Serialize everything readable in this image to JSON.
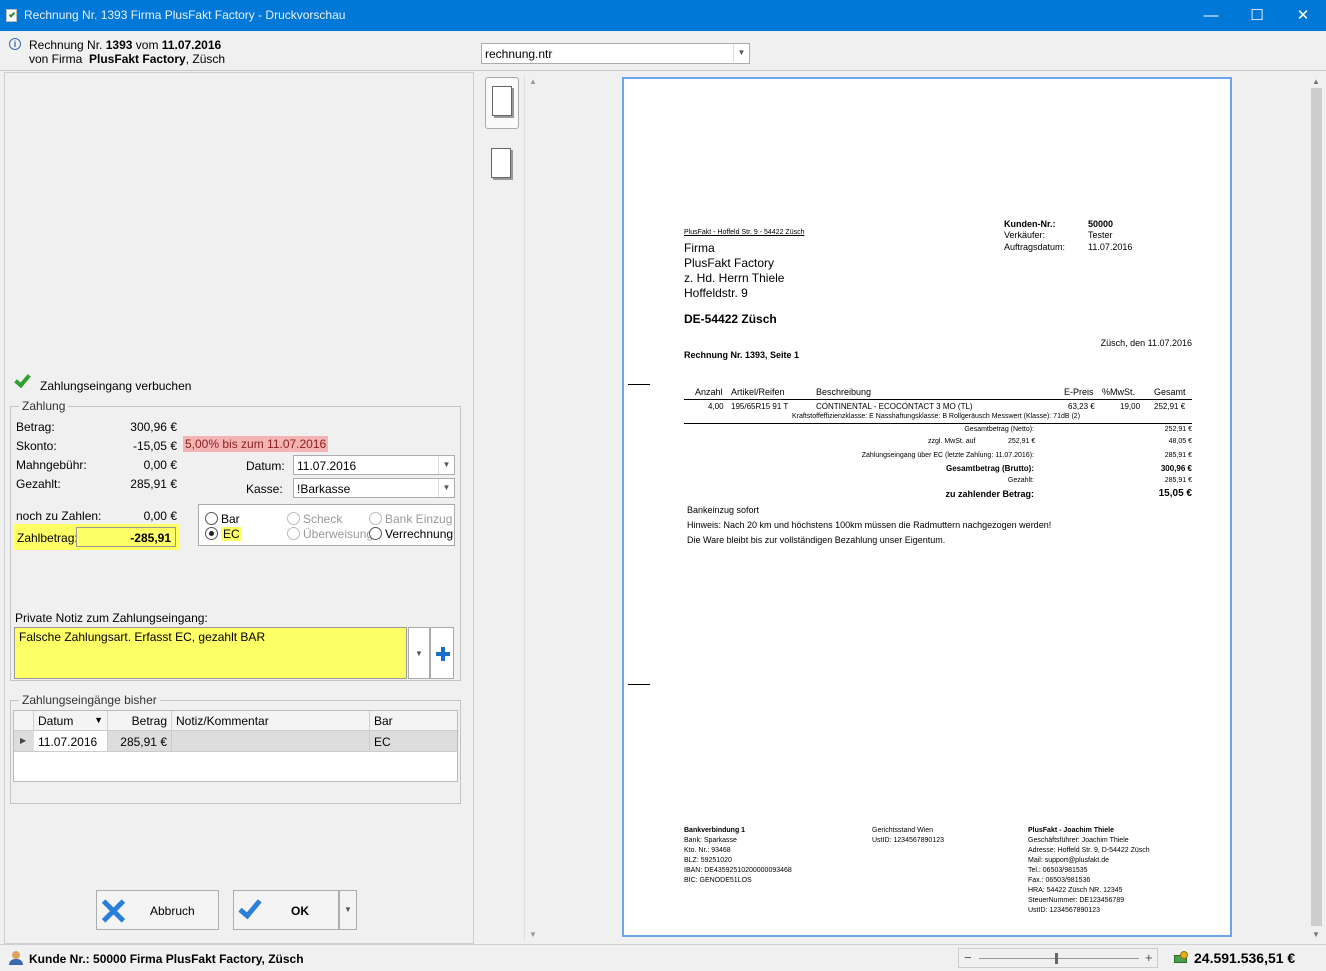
{
  "window": {
    "title": "Rechnung Nr. 1393 Firma PlusFakt Factory - Druckvorschau",
    "controls": {
      "minimize": "—",
      "maximize": "☐",
      "close": "✕"
    }
  },
  "info": {
    "line1_prefix": "Rechnung Nr.",
    "invoice_no": "1393",
    "line1_mid": "vom",
    "invoice_date": "11.07.2016",
    "line2_prefix": "von Firma",
    "company": "PlusFakt Factory",
    "line2_suffix": ", Züsch"
  },
  "template": {
    "value": "rechnung.ntr"
  },
  "payment": {
    "book_label": "Zahlungseingang verbuchen",
    "group_title": "Zahlung",
    "betrag_label": "Betrag:",
    "betrag": "300,96 €",
    "skonto_label": "Skonto:",
    "skonto": "-15,05 €",
    "skonto_note": "5,00% bis zum 11.07.2016",
    "mahn_label": "Mahngebühr:",
    "mahn": "0,00 €",
    "gezahlt_label": "Gezahlt:",
    "gezahlt": "285,91 €",
    "noch_label": "noch zu Zahlen:",
    "noch": "0,00 €",
    "zahlbetrag_label": "Zahlbetrag:",
    "zahlbetrag": "-285,91",
    "datum_label": "Datum:",
    "datum": "11.07.2016",
    "kasse_label": "Kasse:",
    "kasse": "!Barkasse",
    "methods": {
      "bar": "Bar",
      "scheck": "Scheck",
      "bank": "Bank Einzug",
      "ec": "EC",
      "ueberweisung": "Überweisung",
      "verrechnung": "Verrechnung"
    },
    "note_label": "Private Notiz zum Zahlungseingang:",
    "note": "Falsche Zahlungsart. Erfasst EC, gezahlt BAR"
  },
  "history": {
    "title": "Zahlungseingänge bisher",
    "headers": {
      "datum": "Datum",
      "betrag": "Betrag",
      "notiz": "Notiz/Kommentar",
      "bar": "Bar"
    },
    "row": {
      "datum": "11.07.2016",
      "betrag": "285,91 €",
      "notiz": "",
      "bar": "EC"
    }
  },
  "buttons": {
    "cancel": "Abbruch",
    "ok": "OK"
  },
  "doc": {
    "sender": "PlusFakt - Hoffeld Str. 9 - 54422 Züsch",
    "addr1": "Firma",
    "addr2": "PlusFakt Factory",
    "addr3": "z. Hd. Herrn Thiele",
    "addr4": "Hoffeldstr. 9",
    "city": "DE-54422 Züsch",
    "kd_label": "Kunden-Nr.:",
    "kd": "50000",
    "vk_label": "Verkäufer:",
    "vk": "Tester",
    "ad_label": "Auftragsdatum:",
    "ad": "11.07.2016",
    "place_date": "Züsch, den 11.07.2016",
    "heading": "Rechnung Nr. 1393, Seite 1",
    "th": {
      "anzahl": "Anzahl",
      "artikel": "Artikel/Reifen",
      "beschr": "Beschreibung",
      "epreis": "E-Preis",
      "mwst": "%MwSt.",
      "gesamt": "Gesamt"
    },
    "item": {
      "anzahl": "4,00",
      "artikel": "195/65R15 91 T",
      "beschr": "CONTINENTAL - ECOCONTACT 3 MO (TL)",
      "epreis": "63,23 €",
      "mwst": "19,00",
      "gesamt": "252,91 €"
    },
    "item_sub": "Kraftstoffeffizienzklasse: E   Nasshaftungsklasse: B   Rollgeräusch Messwert (Klasse): 71dB (2)",
    "sum_netto_label": "Gesamtbetrag (Netto):",
    "sum_netto": "252,91 €",
    "sum_mwst_label": "zzgl.  MwSt. auf",
    "sum_mwst_base": "252,91 €",
    "sum_mwst": "48,05 €",
    "sum_ze_label": "Zahlungseingang über EC (letzte Zahlung: 11.07.2016):",
    "sum_ze": "285,91 €",
    "sum_brutto_label": "Gesamtbetrag (Brutto):",
    "sum_brutto": "300,96 €",
    "sum_gez_label": "Gezahlt:",
    "sum_gez": "285,91 €",
    "sum_zahl_label": "zu zahlender Betrag:",
    "sum_zahl": "15,05 €",
    "txt1": "Bankeinzug sofort",
    "txt2": "Hinweis: Nach 20 km und höchstens 100km müssen die Radmuttern nachgezogen werden!",
    "txt3": "Die Ware bleibt bis zur vollständigen Bezahlung unser Eigentum.",
    "f1": [
      "Bankverbindung 1",
      "Bank: Sparkasse",
      "Kto. Nr.: 93468",
      "BLZ: 59251020",
      "IBAN: DE43592510200000093468",
      "BIC: GENODE51LOS"
    ],
    "f2": [
      "Gerichtsstand Wien",
      "UstID: 1234567890123"
    ],
    "f3": [
      "PlusFakt - Joachim Thiele",
      "Geschäftsführer: Joachim Thiele",
      "Adresse: Hoffeld Str. 9, D-54422 Züsch",
      "Mail: support@plusfakt.de",
      "Tel.: 06503/981535",
      "Fax.: 06503/981536",
      "HRA: 54422 Züsch NR. 12345",
      "SteuerNummer: DE123456789",
      "UstID: 1234567890123"
    ]
  },
  "status": {
    "customer_prefix": "Kunde  Nr.:",
    "customer": "50000 Firma  PlusFakt Factory, Züsch",
    "total": "24.591.536,51 €"
  },
  "colors": {
    "titlebar": "#0078d7",
    "highlight": "#ffff66",
    "skonto_bg": "#f4b4b4"
  }
}
